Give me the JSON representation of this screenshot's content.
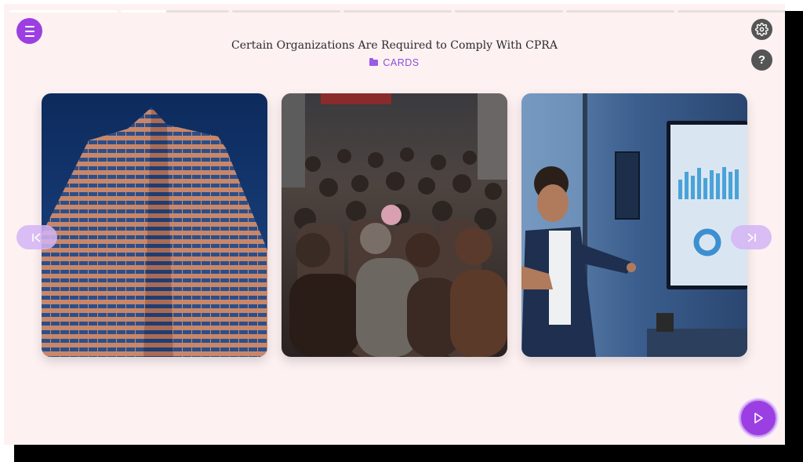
{
  "header": {
    "title": "Certain Organizations Are Required to Comply With CPRA",
    "section_label": "CARDS"
  },
  "progress": {
    "segment_count": 7,
    "segments_fill": [
      1.0,
      0.42,
      0,
      0,
      0,
      0,
      0
    ]
  },
  "cards": [
    {
      "image_description": "skyscraper-photo"
    },
    {
      "image_description": "crowd-photo"
    },
    {
      "image_description": "office-presentation-photo"
    }
  ],
  "icons": {
    "menu": "menu-icon",
    "settings": "gear-icon",
    "help": "question-icon",
    "prev": "skip-back-icon",
    "next": "skip-forward-icon",
    "play": "play-icon"
  },
  "labels": {
    "help_glyph": "?"
  },
  "colors": {
    "accent": "#9b3fe3",
    "background": "#fdf1f2",
    "nav_button": "#d4b4f5"
  }
}
